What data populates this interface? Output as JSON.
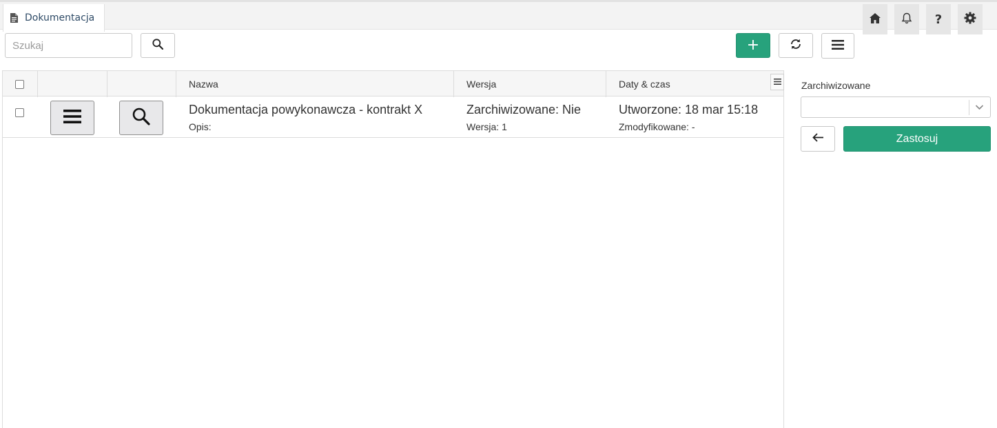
{
  "tab": {
    "label": "Dokumentacja",
    "icon": "document-icon"
  },
  "top_icons": [
    "home-icon",
    "bell-icon",
    "help-icon",
    "settings-icon"
  ],
  "top_icons_text": {
    "help": "?"
  },
  "toolbar": {
    "search_placeholder": "Szukaj",
    "add_label": "+",
    "accent_color": "#27a27c"
  },
  "grid": {
    "columns": [
      "Nazwa",
      "Wersja",
      "Daty & czas"
    ],
    "rows": [
      {
        "name": "Dokumentacja powykonawcza - kontrakt X",
        "description": "Opis:",
        "archived": "Zarchiwizowane: Nie",
        "version": "Wersja: 1",
        "created": "Utworzone: 18 mar 15:18",
        "modified": "Zmodyfikowane: -"
      }
    ]
  },
  "filter": {
    "label": "Zarchiwizowane",
    "selected_value": "",
    "apply_label": "Zastosuj"
  }
}
